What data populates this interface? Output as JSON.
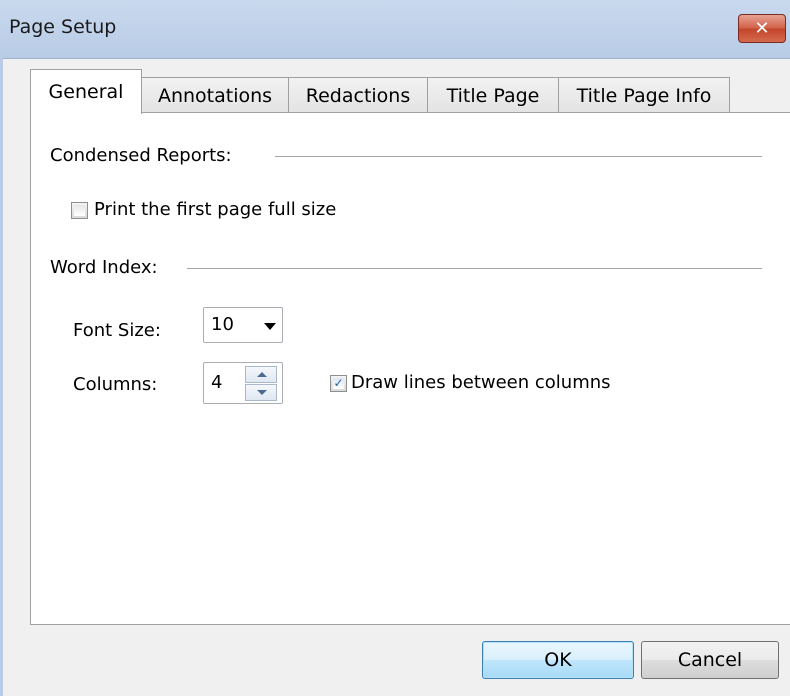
{
  "window": {
    "title": "Page Setup",
    "close_glyph": "✕"
  },
  "tabs": [
    {
      "label": "General",
      "active": true
    },
    {
      "label": "Annotations",
      "active": false
    },
    {
      "label": "Redactions",
      "active": false
    },
    {
      "label": "Title Page",
      "active": false
    },
    {
      "label": "Title Page Info",
      "active": false
    }
  ],
  "condensed_reports": {
    "heading": "Condensed Reports:",
    "print_first_page_label": "Print the first page full size",
    "print_first_page_checked": false
  },
  "word_index": {
    "heading": "Word Index:",
    "font_size_label": "Font Size:",
    "font_size_value": "10",
    "columns_label": "Columns:",
    "columns_value": "4",
    "draw_lines_label": "Draw lines between columns",
    "draw_lines_checked": true,
    "check_glyph": "✓"
  },
  "buttons": {
    "ok": "OK",
    "cancel": "Cancel"
  },
  "colors": {
    "title_bar": "#b8cce6",
    "close_button": "#c3452b",
    "check": "#2a5da8",
    "default_button": "#a7d9f5"
  }
}
